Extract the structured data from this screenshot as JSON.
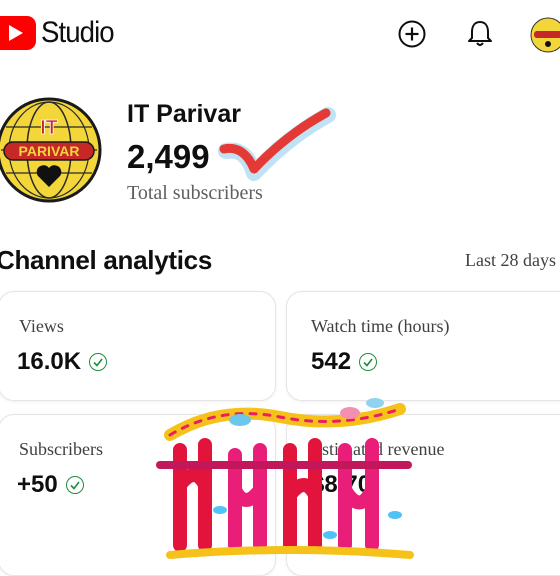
{
  "header": {
    "app_name": "Studio",
    "create_icon": "plus-circle-icon",
    "notifications_icon": "bell-icon",
    "account_icon": "channel-avatar"
  },
  "channel": {
    "name": "IT Parivar",
    "subscriber_count": "2,499",
    "subscriber_label": "Total subscribers",
    "avatar_text_top": "IT",
    "avatar_text_banner": "PARIVAR"
  },
  "analytics": {
    "title": "Channel analytics",
    "range": "Last 28 days",
    "cards": [
      {
        "label": "Views",
        "value": "16.0K"
      },
      {
        "label": "Watch time (hours)",
        "value": "542"
      },
      {
        "label": "Subscribers",
        "value": "+50"
      },
      {
        "label": "Estimated revenue",
        "value": "$8.70"
      }
    ]
  },
  "colors": {
    "brand_red": "#ff0000",
    "check_green": "#1e8e3e",
    "tick_red": "#e53935",
    "tick_glow": "#bfe3f5",
    "avatar_yellow": "#f2d63a"
  }
}
